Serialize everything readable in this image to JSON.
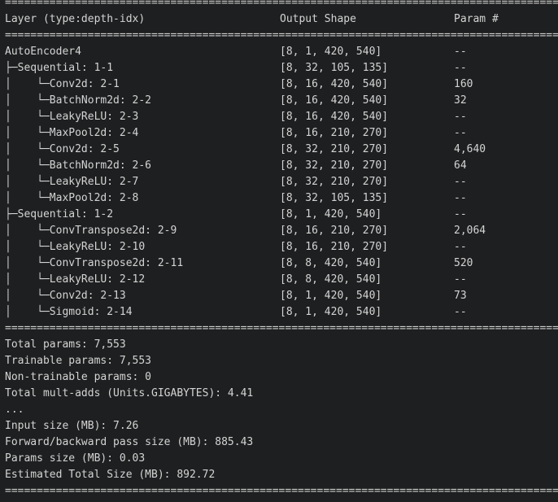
{
  "separator": "==================================================================================================",
  "header": {
    "layer": "Layer (type:depth-idx)",
    "shape": "Output Shape",
    "param": "Param #"
  },
  "rows": [
    {
      "layer": "AutoEncoder4",
      "shape": "[8, 1, 420, 540]",
      "param": "--"
    },
    {
      "layer": "├─Sequential: 1-1",
      "shape": "[8, 32, 105, 135]",
      "param": "--"
    },
    {
      "layer": "│    └─Conv2d: 2-1",
      "shape": "[8, 16, 420, 540]",
      "param": "160"
    },
    {
      "layer": "│    └─BatchNorm2d: 2-2",
      "shape": "[8, 16, 420, 540]",
      "param": "32"
    },
    {
      "layer": "│    └─LeakyReLU: 2-3",
      "shape": "[8, 16, 420, 540]",
      "param": "--"
    },
    {
      "layer": "│    └─MaxPool2d: 2-4",
      "shape": "[8, 16, 210, 270]",
      "param": "--"
    },
    {
      "layer": "│    └─Conv2d: 2-5",
      "shape": "[8, 32, 210, 270]",
      "param": "4,640"
    },
    {
      "layer": "│    └─BatchNorm2d: 2-6",
      "shape": "[8, 32, 210, 270]",
      "param": "64"
    },
    {
      "layer": "│    └─LeakyReLU: 2-7",
      "shape": "[8, 32, 210, 270]",
      "param": "--"
    },
    {
      "layer": "│    └─MaxPool2d: 2-8",
      "shape": "[8, 32, 105, 135]",
      "param": "--"
    },
    {
      "layer": "├─Sequential: 1-2",
      "shape": "[8, 1, 420, 540]",
      "param": "--"
    },
    {
      "layer": "│    └─ConvTranspose2d: 2-9",
      "shape": "[8, 16, 210, 270]",
      "param": "2,064"
    },
    {
      "layer": "│    └─LeakyReLU: 2-10",
      "shape": "[8, 16, 210, 270]",
      "param": "--"
    },
    {
      "layer": "│    └─ConvTranspose2d: 2-11",
      "shape": "[8, 8, 420, 540]",
      "param": "520"
    },
    {
      "layer": "│    └─LeakyReLU: 2-12",
      "shape": "[8, 8, 420, 540]",
      "param": "--"
    },
    {
      "layer": "│    └─Conv2d: 2-13",
      "shape": "[8, 1, 420, 540]",
      "param": "73"
    },
    {
      "layer": "│    └─Sigmoid: 2-14",
      "shape": "[8, 1, 420, 540]",
      "param": "--"
    }
  ],
  "summary": [
    "Total params: 7,553",
    "Trainable params: 7,553",
    "Non-trainable params: 0",
    "Total mult-adds (Units.GIGABYTES): 4.41",
    "..."
  ],
  "sizes": [
    "Input size (MB): 7.26",
    "Forward/backward pass size (MB): 885.43",
    "Params size (MB): 0.03",
    "Estimated Total Size (MB): 892.72"
  ]
}
